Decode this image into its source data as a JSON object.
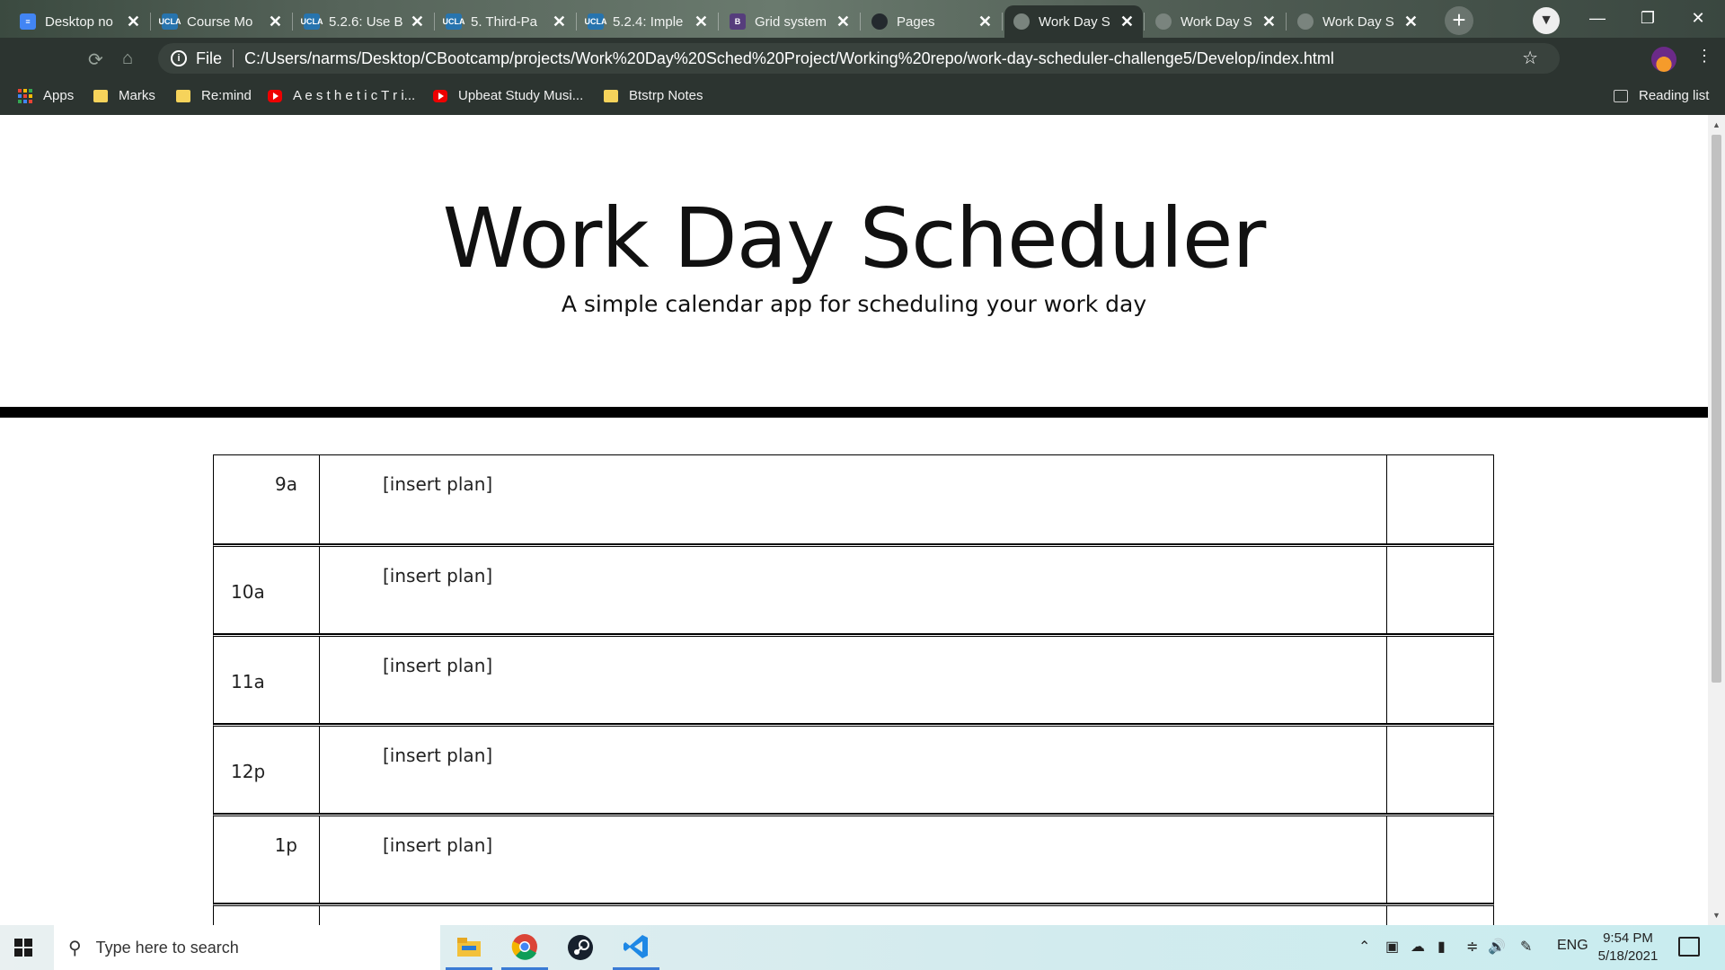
{
  "browser": {
    "tabs": [
      {
        "title": "Desktop no",
        "favicon": "docs-icon",
        "color": "#4285f4"
      },
      {
        "title": "Course Mo",
        "favicon": "ucla-icon",
        "color": "#2774ae"
      },
      {
        "title": "5.2.6: Use B",
        "favicon": "ucla-icon",
        "color": "#2774ae"
      },
      {
        "title": "5. Third-Pa",
        "favicon": "ucla-icon",
        "color": "#2774ae"
      },
      {
        "title": "5.2.4: Imple",
        "favicon": "ucla-icon",
        "color": "#2774ae"
      },
      {
        "title": "Grid system",
        "favicon": "bootstrap-icon",
        "color": "#563d7c"
      },
      {
        "title": "Pages",
        "favicon": "github-icon",
        "color": "#24292e"
      },
      {
        "title": "Work Day S",
        "favicon": "globe-icon",
        "color": "#7a847e"
      },
      {
        "title": "Work Day S",
        "favicon": "globe-icon",
        "color": "#7a847e"
      },
      {
        "title": "Work Day S",
        "favicon": "globe-icon",
        "color": "#7a847e"
      }
    ],
    "active_tab_index": 7,
    "address": {
      "scheme_label": "File",
      "url": "C:/Users/narms/Desktop/CBootcamp/projects/Work%20Day%20Sched%20Project/Working%20repo/work-day-scheduler-challenge5/Develop/index.html"
    },
    "bookmarks": [
      {
        "label": "Apps",
        "icon": "apps-grid-icon"
      },
      {
        "label": "Marks",
        "icon": "folder-icon"
      },
      {
        "label": "Re:mind",
        "icon": "folder-icon"
      },
      {
        "label": "A e s t h e t i c T r i...",
        "icon": "youtube-icon"
      },
      {
        "label": "Upbeat Study Musi...",
        "icon": "youtube-icon"
      },
      {
        "label": "Btstrp Notes",
        "icon": "folder-icon"
      }
    ],
    "reading_list_label": "Reading list"
  },
  "page": {
    "title": "Work Day Scheduler",
    "subtitle": "A simple calendar app for scheduling your work day",
    "time_blocks": [
      {
        "hour": "9a",
        "plan": "[insert plan]"
      },
      {
        "hour": "10a",
        "plan": "[insert plan]"
      },
      {
        "hour": "11a",
        "plan": "[insert plan]"
      },
      {
        "hour": "12p",
        "plan": "[insert plan]"
      },
      {
        "hour": "1p",
        "plan": "[insert plan]"
      }
    ]
  },
  "taskbar": {
    "search_placeholder": "Type here to search",
    "apps": [
      "file-explorer-icon",
      "chrome-icon",
      "steam-icon",
      "vscode-icon"
    ],
    "language": "ENG",
    "time": "9:54 PM",
    "date": "5/18/2021"
  },
  "colors": {
    "chrome_bg": "#2c3430",
    "hr_bar": "#000000",
    "taskbar_bg": "#d4ebee"
  }
}
